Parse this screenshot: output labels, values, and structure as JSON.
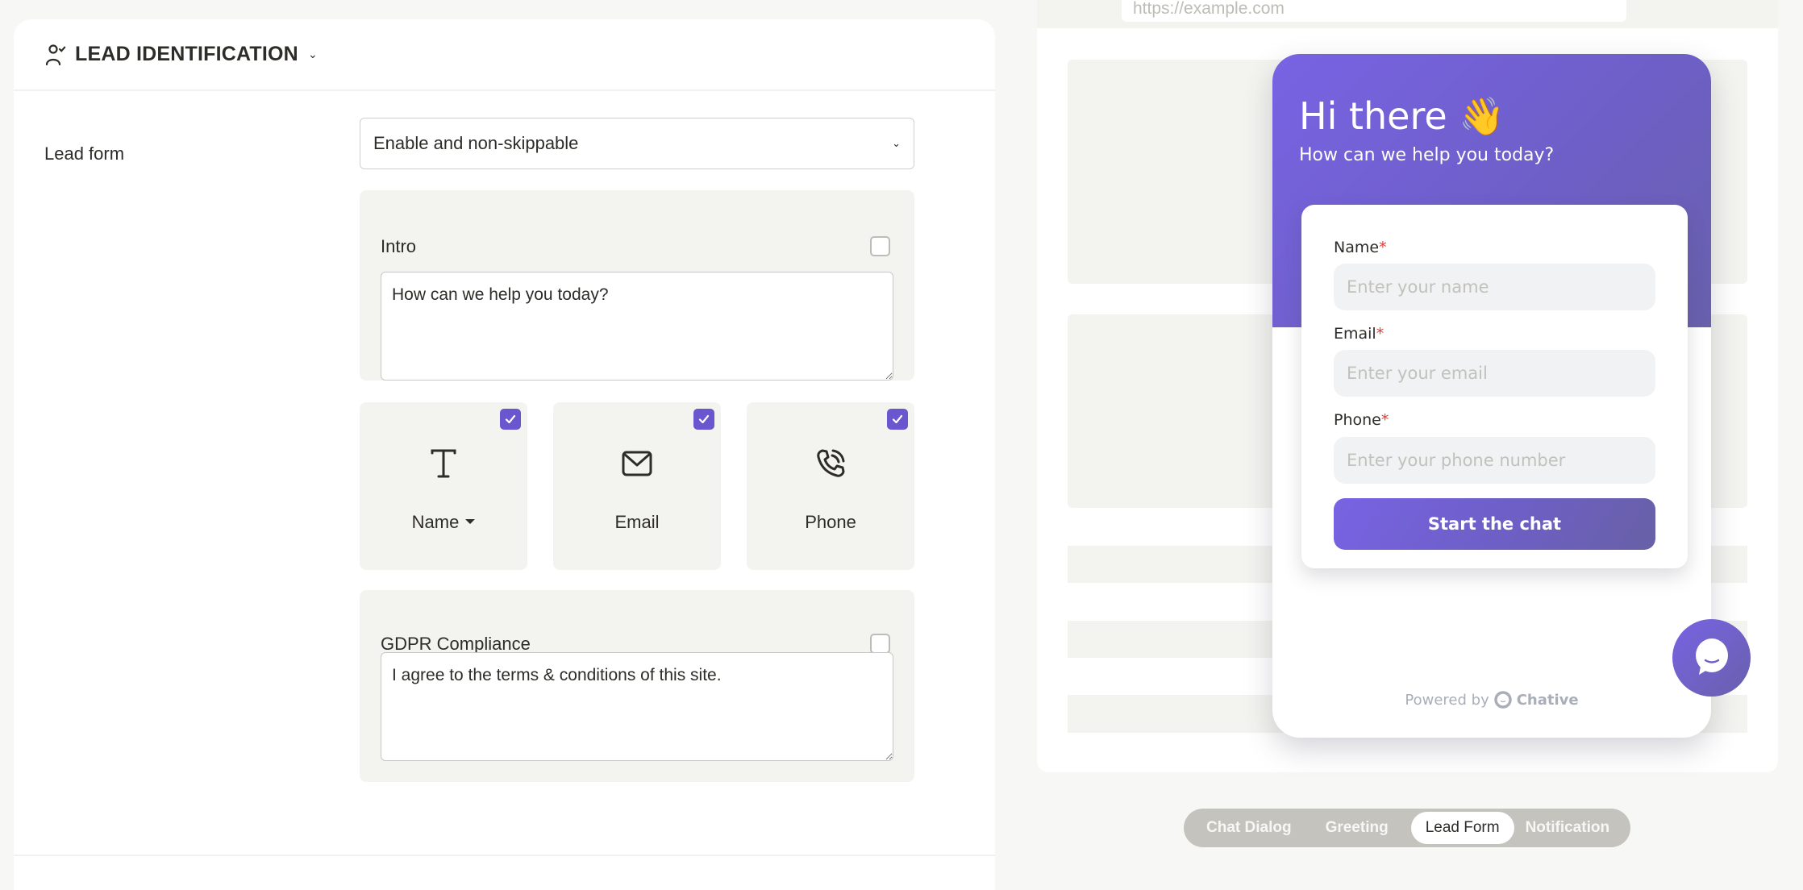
{
  "settings": {
    "section_title": "LEAD IDENTIFICATION",
    "lead_form_label": "Lead form",
    "lead_form_select": {
      "selected": "Enable and non-skippable"
    },
    "intro": {
      "label": "Intro",
      "enabled": false,
      "text": "How can we help you today?"
    },
    "fields": [
      {
        "label": "Name",
        "icon": "text-t-icon",
        "checked": true,
        "has_dropdown": true
      },
      {
        "label": "Email",
        "icon": "envelope-icon",
        "checked": true,
        "has_dropdown": false
      },
      {
        "label": "Phone",
        "icon": "phone-call-icon",
        "checked": true,
        "has_dropdown": false
      }
    ],
    "gdpr": {
      "label": "GDPR Compliance",
      "enabled": false,
      "text": "I agree to the terms & conditions of this site."
    }
  },
  "preview": {
    "url_placeholder": "https://example.com",
    "widget": {
      "title": "Hi there 👋",
      "subtitle": "How can we help you today?",
      "form": {
        "fields": [
          {
            "label": "Name",
            "required_mark": "*",
            "placeholder": "Enter your name"
          },
          {
            "label": "Email",
            "required_mark": "*",
            "placeholder": "Enter your email"
          },
          {
            "label": "Phone",
            "required_mark": "*",
            "placeholder": "Enter your phone number"
          }
        ],
        "submit_label": "Start the chat"
      },
      "powered_by": "Powered by",
      "brand": "Chative"
    },
    "colors": {
      "accent": "#6a57d0",
      "gradient_start": "#7863e3",
      "gradient_end": "#6860ac"
    }
  },
  "tabs": {
    "items": [
      {
        "label": "Chat Dialog",
        "active": false
      },
      {
        "label": "Greeting",
        "active": false
      },
      {
        "label": "Lead Form",
        "active": true
      },
      {
        "label": "Notification",
        "active": false
      }
    ]
  }
}
